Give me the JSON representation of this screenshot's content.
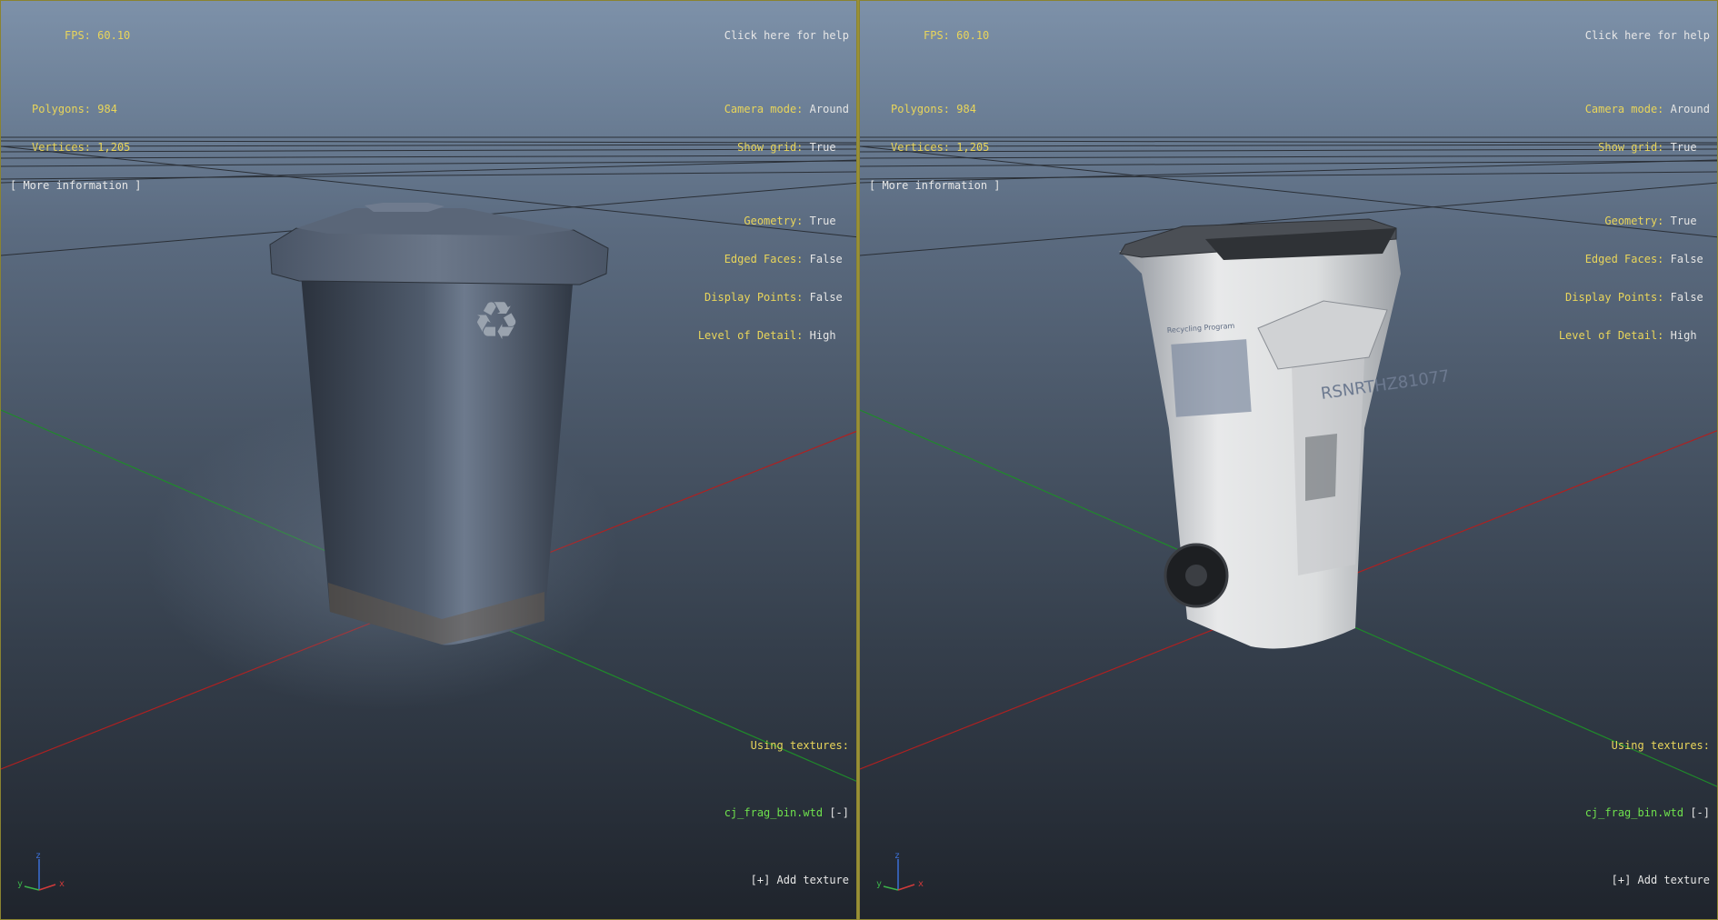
{
  "hud_left": {
    "fps_label": "FPS:",
    "fps_value": "60.10",
    "polygons_label": "Polygons:",
    "polygons_value": "984",
    "vertices_label": "Vertices:",
    "vertices_value": "1,205",
    "more_info": "[ More information ]"
  },
  "hud_right": {
    "help": "Click here for help",
    "camera_mode_label": "Camera mode:",
    "camera_mode_value": "Around",
    "show_grid_label": "Show grid:",
    "show_grid_value": "True",
    "geometry_label": "Geometry:",
    "geometry_value": "True",
    "edged_faces_label": "Edged Faces:",
    "edged_faces_value": "False",
    "display_points_label": "Display Points:",
    "display_points_value": "False",
    "lod_label": "Level of Detail:",
    "lod_value": "High"
  },
  "textures": {
    "label": "Using textures:",
    "file": "cj_frag_bin.wtd",
    "remove": "[-]",
    "add": "[+] Add texture"
  },
  "axis_labels": {
    "x": "x",
    "y": "y",
    "z": "z"
  },
  "bin_right_text": {
    "serial": "RSNRTHZ81077",
    "panel": "Recycling Program"
  },
  "colors": {
    "hud_label": "#e9d55a",
    "hud_value": "#e6e6e6",
    "texture_file": "#6ee04d",
    "grid_x_axis": "#b02020",
    "grid_z_axis": "#1f8a2a",
    "border": "#9a9036"
  }
}
